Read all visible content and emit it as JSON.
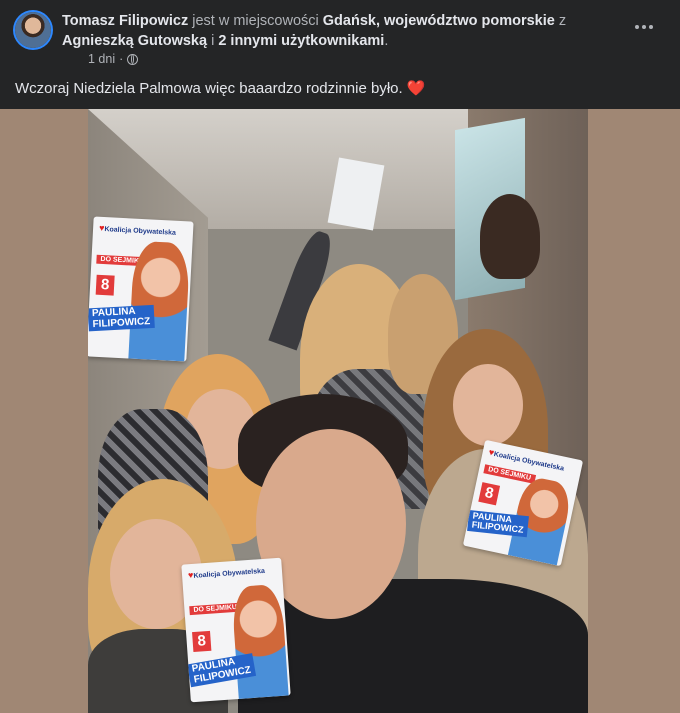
{
  "post": {
    "author": "Tomasz Filipowicz",
    "connector_place": " jest w miejscowości ",
    "location": "Gdańsk, województwo pomorskie",
    "connector_with": " z ",
    "tagged_user": "Agnieszką Gutowską",
    "connector_and": " i ",
    "others": "2 innymi użytkownikami",
    "period": ".",
    "timestamp": "1 dni",
    "separator": " · ",
    "audience_icon": "globe-icon",
    "text": "Wczoraj Niedziela Palmowa więc baaardzo rodzinnie było.",
    "emoji": "❤️"
  },
  "flyers": [
    {
      "logo": "Koalicja Obywatelska",
      "tag": "DO SEJMIKU",
      "number": "8",
      "name_line1": "PAULINA",
      "name_line2": "FILIPOWICZ"
    },
    {
      "logo": "Koalicja Obywatelska",
      "tag": "DO SEJMIKU",
      "number": "8",
      "name_line1": "PAULINA",
      "name_line2": "FILIPOWICZ"
    },
    {
      "logo": "Koalicja Obywatelska",
      "tag": "DO SEJMIKU",
      "number": "8",
      "name_line1": "PAULINA",
      "name_line2": "FILIPOWICZ"
    }
  ],
  "colors": {
    "background": "#242526",
    "text": "#e4e6eb",
    "muted": "#b0b3b8",
    "photo_frame": "#a08774",
    "accent": "#2d88ff",
    "heart": "#f02849"
  }
}
